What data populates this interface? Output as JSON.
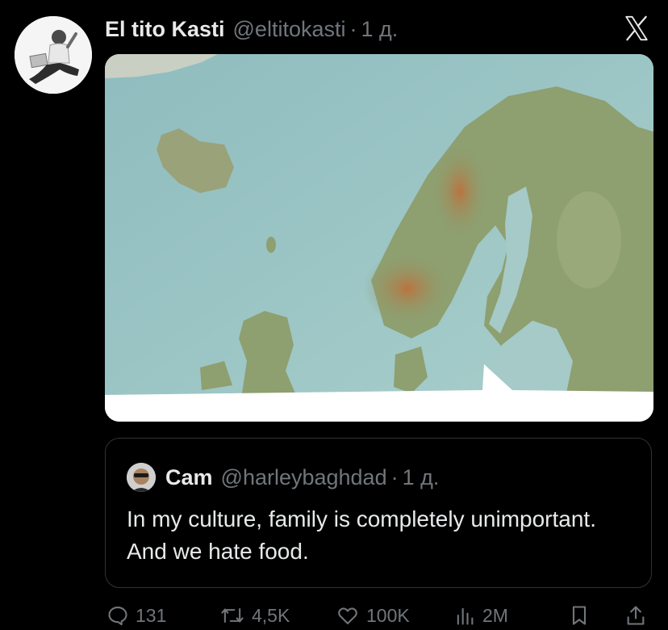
{
  "tweet": {
    "display_name": "El tito Kasti",
    "handle": "@eltitokasti",
    "separator": "·",
    "time": "1 д."
  },
  "quoted_tweet": {
    "display_name": "Cam",
    "handle": "@harleybaghdad",
    "separator": "·",
    "time": "1 д.",
    "text": "In my culture, family is completely unimportant. And we hate food."
  },
  "actions": {
    "replies": "131",
    "reposts": "4,5K",
    "likes": "100K",
    "views": "2M"
  },
  "colors": {
    "background": "#000000",
    "primary_text": "#e7e9ea",
    "secondary_text": "#71767b",
    "border": "#2f3336",
    "sea": "#9dc6c7",
    "land": "#8e9f70"
  },
  "icons": [
    "x-logo-icon",
    "reply-icon",
    "repost-icon",
    "like-icon",
    "views-icon",
    "bookmark-icon",
    "share-icon"
  ]
}
